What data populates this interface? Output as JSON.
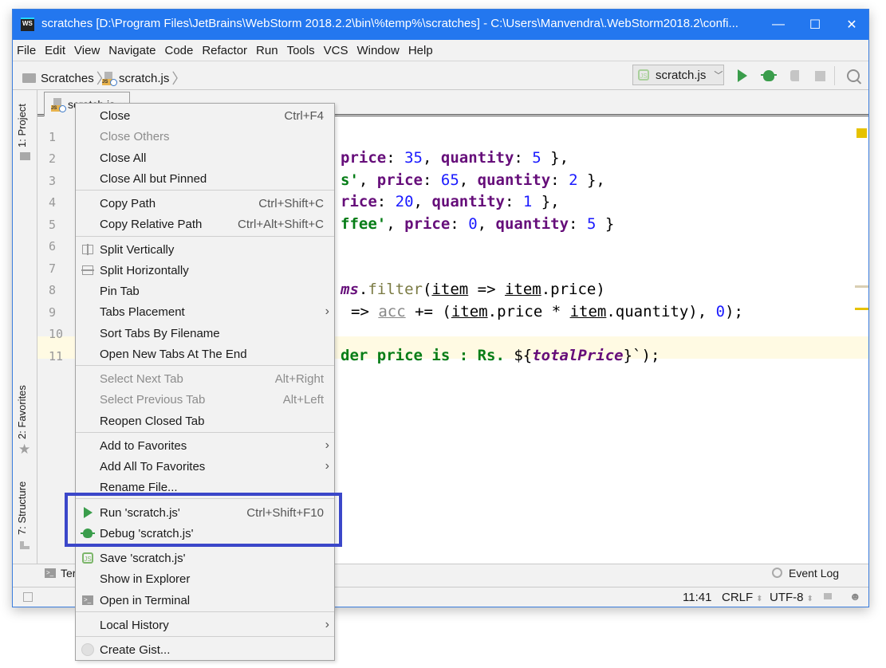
{
  "window": {
    "title": "scratches [D:\\Program Files\\JetBrains\\WebStorm 2018.2.2\\bin\\%temp%\\scratches] - C:\\Users\\Manvendra\\.WebStorm2018.2\\confi...",
    "app_icon_label": "WS",
    "controls": {
      "minimize": "—",
      "maximize": "☐",
      "close": "✕"
    }
  },
  "menubar": {
    "items": [
      "File",
      "Edit",
      "View",
      "Navigate",
      "Code",
      "Refactor",
      "Run",
      "Tools",
      "VCS",
      "Window",
      "Help"
    ]
  },
  "navbar": {
    "breadcrumbs": [
      "Scratches",
      "scratch.js"
    ],
    "run_config": "scratch.js",
    "toolbar_icons": [
      "run-icon",
      "debug-icon",
      "coverage-icon",
      "stop-icon",
      "search-icon"
    ]
  },
  "left_strip": {
    "tabs": [
      "1: Project",
      "2: Favorites",
      "7: Structure"
    ]
  },
  "editor": {
    "tab": {
      "label": "scratch.js",
      "close": "×"
    },
    "line_numbers": [
      "1",
      "2",
      "3",
      "4",
      "5",
      "6",
      "7",
      "8",
      "9",
      "10",
      "11"
    ],
    "visible_code": {
      "line2": {
        "kw1": "price",
        "p1": ": ",
        "n1": "35",
        "p2": ", ",
        "kw2": "quantity",
        "p3": ": ",
        "n2": "5",
        "p4": " },"
      },
      "line3": {
        "s": "s'",
        "p0": ", ",
        "kw1": "price",
        "p1": ": ",
        "n1": "65",
        "p2": ", ",
        "kw2": "quantity",
        "p3": ": ",
        "n2": "2",
        "p4": " },"
      },
      "line4": {
        "kw1": "rice",
        "p1": ": ",
        "n1": "20",
        "p2": ", ",
        "kw2": "quantity",
        "p3": ": ",
        "n2": "1",
        "p4": " },"
      },
      "line5": {
        "s": "ffee'",
        "p0": ", ",
        "kw1": "price",
        "p1": ": ",
        "n1": "0",
        "p2": ", ",
        "kw2": "quantity",
        "p3": ": ",
        "n2": "5",
        "p4": " }"
      },
      "line8": {
        "it": "ms",
        "p0": ".",
        "fn": "filter",
        "p1": "(",
        "u1": "item",
        "p2": " => ",
        "u2": "item",
        "p3": ".price)"
      },
      "line9": {
        "p0": "=> ",
        "u1": "acc",
        "p1": " += (",
        "u2": "item",
        "p2": ".price * ",
        "u3": "item",
        "p3": ".quantity), ",
        "n1": "0",
        "p4": ");"
      },
      "line11": {
        "s": "der price is : Rs. ",
        "p0": "${",
        "it": "totalPrice",
        "p1": "}`);"
      }
    }
  },
  "context_menu": {
    "items": [
      {
        "label": "Close",
        "shortcut": "Ctrl+F4"
      },
      {
        "label": "Close Others",
        "disabled": true
      },
      {
        "label": "Close All"
      },
      {
        "label": "Close All but Pinned"
      },
      {
        "label": "Copy Path",
        "shortcut": "Ctrl+Shift+C"
      },
      {
        "label": "Copy Relative Path",
        "shortcut": "Ctrl+Alt+Shift+C"
      },
      {
        "label": "Split Vertically",
        "icon": "split-vertically-icon"
      },
      {
        "label": "Split Horizontally",
        "icon": "split-horizontally-icon"
      },
      {
        "label": "Pin Tab"
      },
      {
        "label": "Tabs Placement",
        "submenu": true
      },
      {
        "label": "Sort Tabs By Filename"
      },
      {
        "label": "Open New Tabs At The End"
      },
      {
        "label": "Select Next Tab",
        "shortcut": "Alt+Right",
        "disabled": true
      },
      {
        "label": "Select Previous Tab",
        "shortcut": "Alt+Left",
        "disabled": true
      },
      {
        "label": "Reopen Closed Tab"
      },
      {
        "label": "Add to Favorites",
        "submenu": true
      },
      {
        "label": "Add All To Favorites",
        "submenu": true
      },
      {
        "label": "Rename File..."
      },
      {
        "label": "Run 'scratch.js'",
        "shortcut": "Ctrl+Shift+F10",
        "icon": "run-icon"
      },
      {
        "label": "Debug 'scratch.js'",
        "icon": "debug-icon"
      },
      {
        "label": "Save 'scratch.js'",
        "icon": "nodejs-icon"
      },
      {
        "label": "Show in Explorer"
      },
      {
        "label": "Open in Terminal",
        "icon": "terminal-icon"
      },
      {
        "label": "Local History",
        "submenu": true
      },
      {
        "label": "Create Gist...",
        "icon": "github-icon"
      }
    ],
    "submenu_glyph": "›"
  },
  "bottom_bar": {
    "terminal_label": "Ter",
    "event_log": "Event Log"
  },
  "status_bar": {
    "position": "11:41",
    "line_separator": "CRLF",
    "encoding": "UTF-8",
    "updown": "⬍"
  },
  "colors": {
    "titlebar": "#2377ef",
    "highlight_box": "#3b47c9",
    "run_green": "#3a9d4b",
    "current_line": "#fffae3",
    "keyword": "#660e7a",
    "number": "#1a1aff",
    "string": "#067d17"
  }
}
